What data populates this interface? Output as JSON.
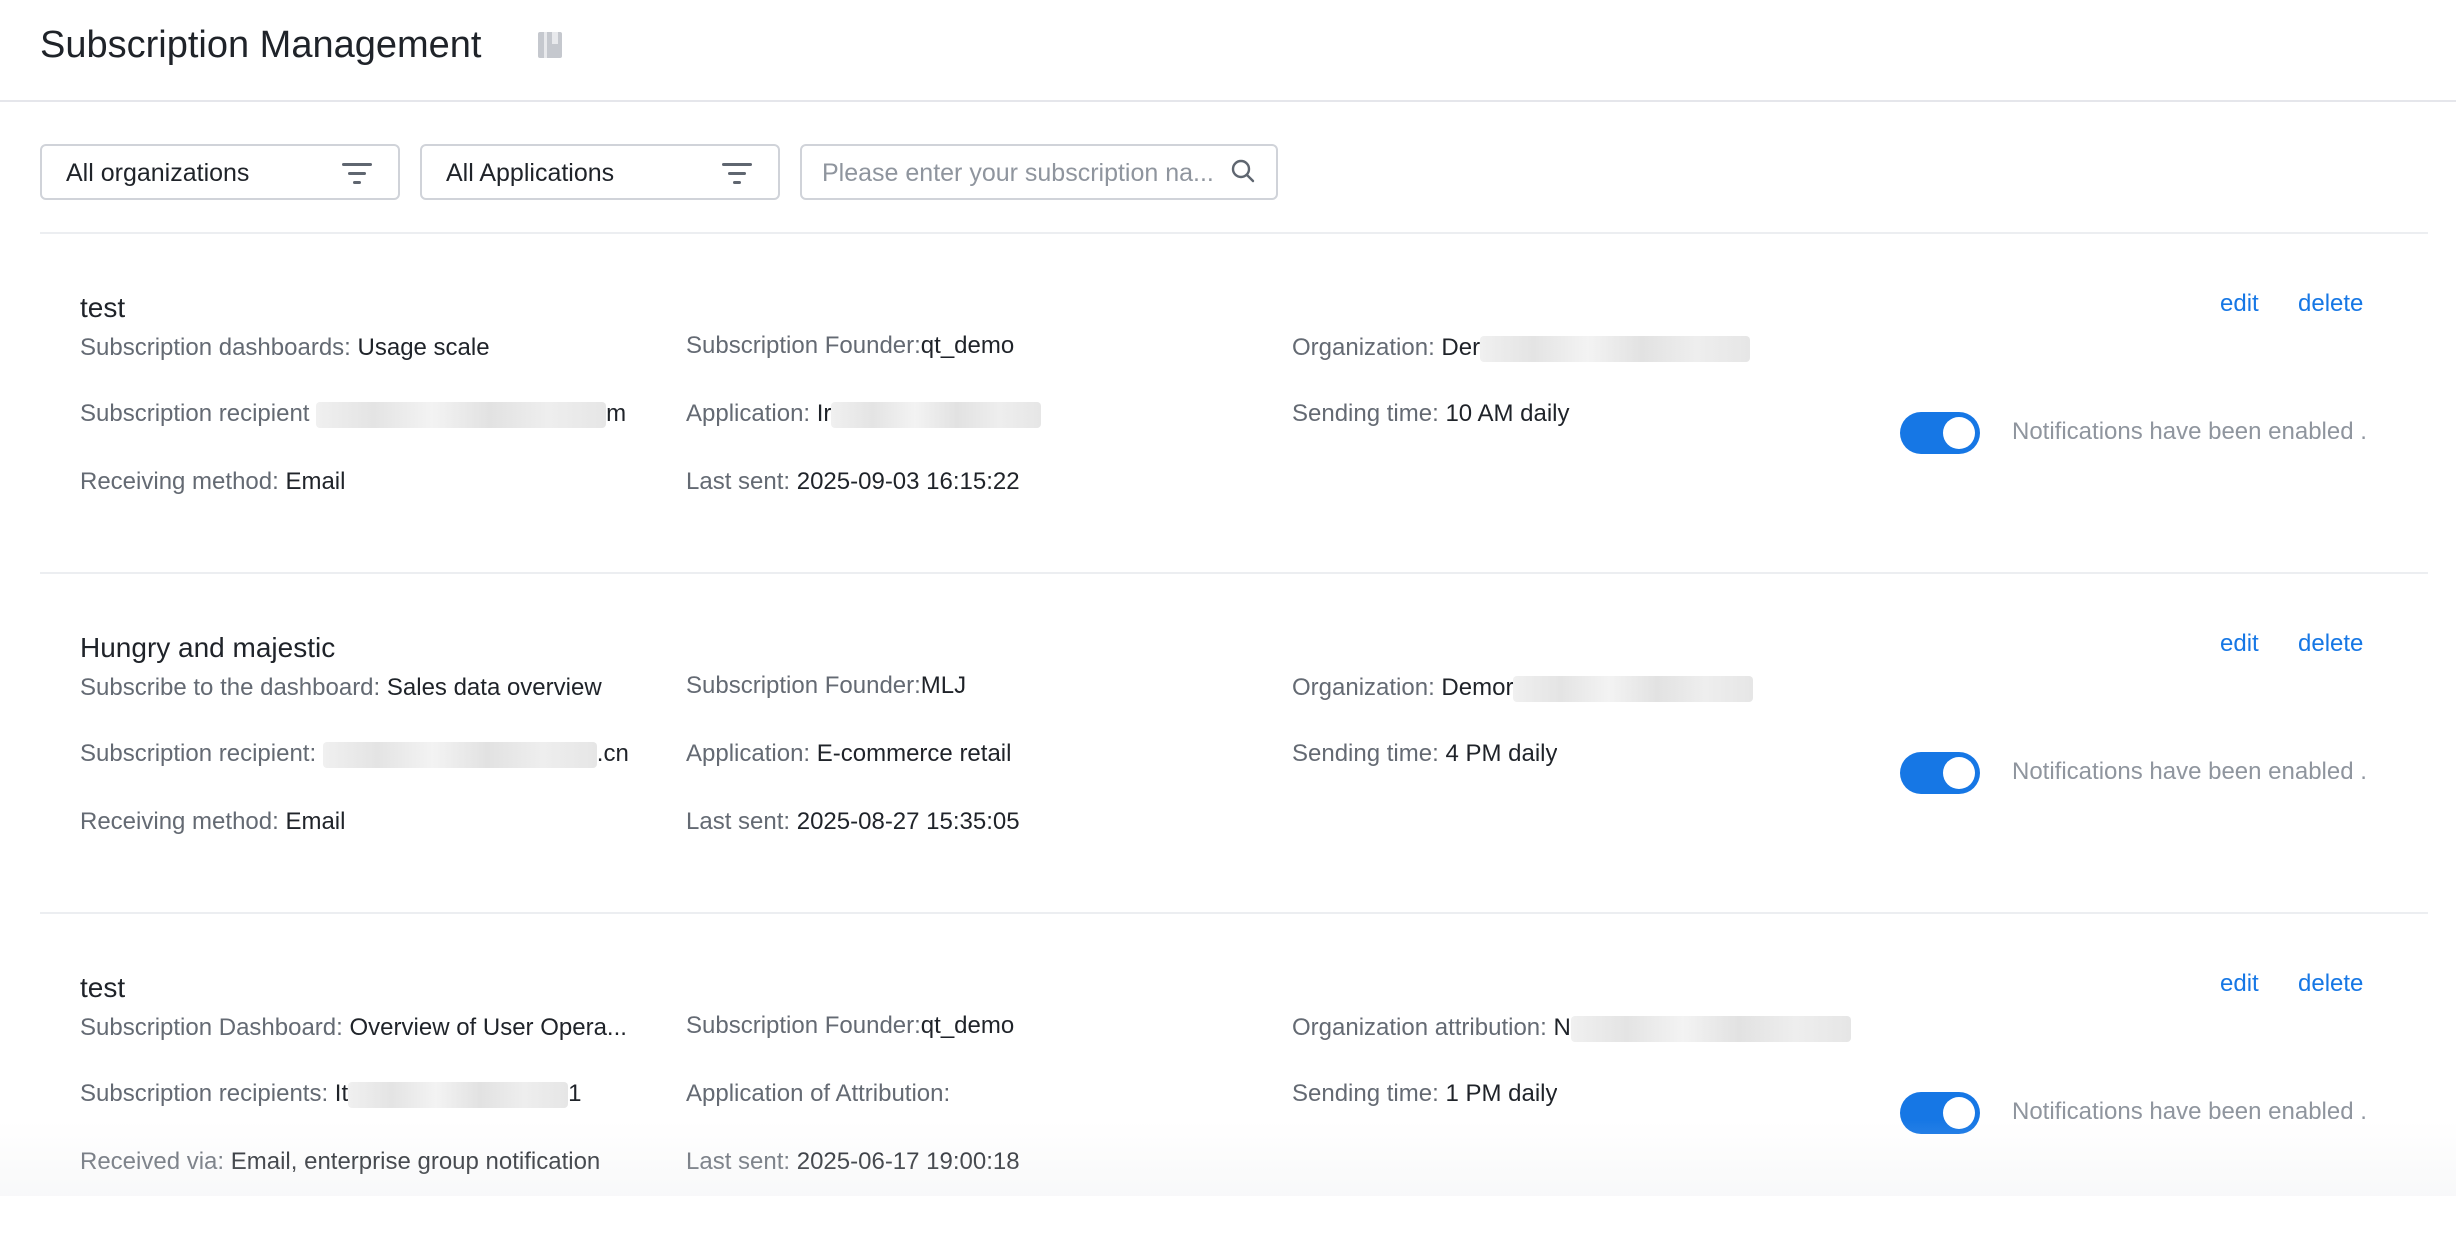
{
  "header": {
    "title": "Subscription Management",
    "title_icon": "book-icon"
  },
  "filters": {
    "organization": {
      "value": "All organizations",
      "icon": "filter-icon"
    },
    "application": {
      "value": "All Applications",
      "icon": "filter-icon"
    },
    "search": {
      "placeholder": "Please enter your subscription na...",
      "icon": "search-icon"
    }
  },
  "accent_color": "#1677e5",
  "subscriptions": [
    {
      "title": "test",
      "dashboard_label": "Subscription dashboards:",
      "dashboard_value": "Usage scale",
      "recipient_label": "Subscription recipient",
      "recipient_suffix": "m",
      "method_label": "Receiving method:",
      "method_value": "Email",
      "founder_label": "Subscription Founder:",
      "founder_value": "qt_demo",
      "app_label": "Application:",
      "app_value": "Ir",
      "last_label": "Last sent:",
      "last_value": "2025-09-03 16:15:22",
      "org_label": "Organization:",
      "org_value": "Der",
      "time_label": "Sending time:",
      "time_value": "10 AM daily",
      "edit": "edit",
      "delete": "delete",
      "enabled": true,
      "notify_text": "Notifications have been enabled ."
    },
    {
      "title": "Hungry and majestic",
      "dashboard_label": "Subscribe to the dashboard:",
      "dashboard_value": "Sales data overview",
      "recipient_label": "Subscription recipient:",
      "recipient_suffix": ".cn",
      "method_label": "Receiving method:",
      "method_value": "Email",
      "founder_label": "Subscription Founder:",
      "founder_value": "MLJ",
      "app_label": "Application:",
      "app_value": "E-commerce retail",
      "last_label": "Last sent:",
      "last_value": "2025-08-27 15:35:05",
      "org_label": "Organization:",
      "org_value": "Demor",
      "time_label": "Sending time:",
      "time_value": "4 PM daily",
      "edit": "edit",
      "delete": "delete",
      "enabled": true,
      "notify_text": "Notifications have been enabled ."
    },
    {
      "title": "test",
      "dashboard_label": "Subscription Dashboard:",
      "dashboard_value": "Overview of User Opera...",
      "recipient_label": "Subscription recipients:",
      "recipient_prefix": "It",
      "recipient_suffix": "1",
      "method_label": "Received via:",
      "method_value": "Email, enterprise group notification",
      "founder_label": "Subscription Founder:",
      "founder_value": "qt_demo",
      "app_label": "Application of Attribution:",
      "app_value": "",
      "last_label": "Last sent:",
      "last_value": "2025-06-17 19:00:18",
      "org_label": "Organization attribution:",
      "org_value": "N",
      "time_label": "Sending time:",
      "time_value": "1 PM daily",
      "edit": "edit",
      "delete": "delete",
      "enabled": true,
      "notify_text": "Notifications have been enabled ."
    }
  ]
}
